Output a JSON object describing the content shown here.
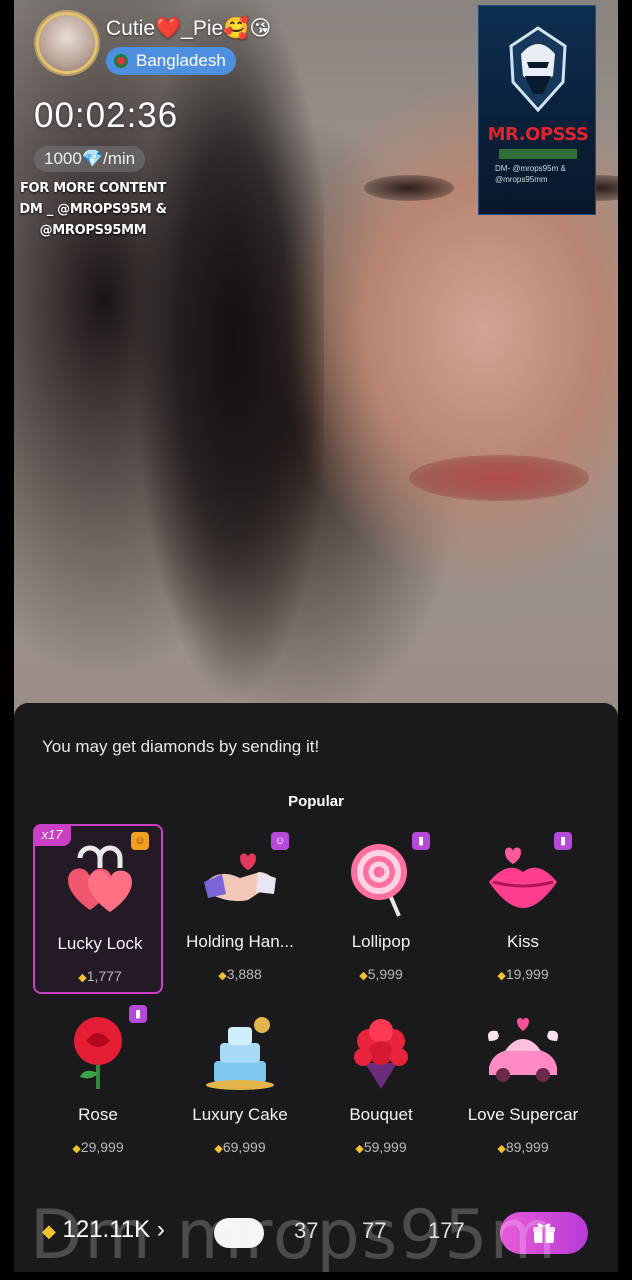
{
  "host": {
    "name": "Cutie❤️_Pie🥰😘",
    "country": "Bangladesh"
  },
  "call": {
    "timer": "00:02:36",
    "rate_value": "1000",
    "rate_unit": "/min"
  },
  "overlay_text": {
    "promo": "FOR MORE CONTENT DM _ @MROPS95M & @MROPS95MM"
  },
  "logo": {
    "title": "MR.OPSSS",
    "dm_text": "DM- @mrops95m & @mrops95mm"
  },
  "gift_panel": {
    "hint": "You may get diamonds by sending it!",
    "section": "Popular",
    "gifts": [
      {
        "name": "Lucky Lock",
        "price": "1,777",
        "combo": "x17",
        "badge": "orange",
        "selected": true
      },
      {
        "name": "Holding Han...",
        "price": "3,888",
        "badge": "purple",
        "selected": false
      },
      {
        "name": "Lollipop",
        "price": "5,999",
        "badge": "purple",
        "selected": false
      },
      {
        "name": "Kiss",
        "price": "19,999",
        "badge": "purple",
        "selected": false
      },
      {
        "name": "Rose",
        "price": "29,999",
        "badge": "purple",
        "selected": false
      },
      {
        "name": "Luxury Cake",
        "price": "69,999",
        "selected": false
      },
      {
        "name": "Bouquet",
        "price": "59,999",
        "selected": false
      },
      {
        "name": "Love Supercar",
        "price": "89,999",
        "selected": false
      }
    ]
  },
  "bottom_bar": {
    "balance": "121.11K",
    "quantities": [
      "37",
      "77",
      "177"
    ],
    "watermark": "Dm mrops95m"
  },
  "colors": {
    "accent": "#c93fc6",
    "gem": "#f2c230",
    "sheet_bg": "#1a1a1c",
    "country_pill": "#4f8fe0"
  },
  "icons": {
    "gem": "diamond-icon",
    "send": "gift-send-icon",
    "chevron": "chevron-right-icon"
  }
}
